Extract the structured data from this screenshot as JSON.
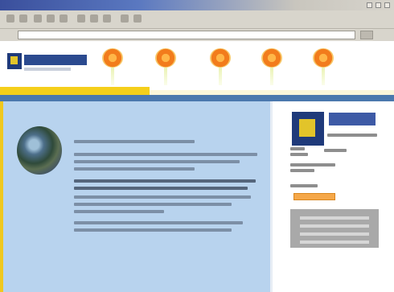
{
  "window": {
    "title": ""
  },
  "address_bar": {
    "url": ""
  },
  "site": {
    "name": "",
    "tagline": ""
  },
  "nav": {
    "items": [
      {
        "label": ""
      },
      {
        "label": ""
      },
      {
        "label": ""
      },
      {
        "label": ""
      },
      {
        "label": ""
      }
    ]
  },
  "main": {
    "headline": "",
    "meta": "",
    "bottom_link": ""
  },
  "sidebar": {
    "name": "",
    "button_label": ""
  },
  "colors": {
    "accent_yellow": "#f5cf1a",
    "header_blue": "#4b78ad",
    "content_blue": "#b8d3ee",
    "nav_orange": "#f27c1c",
    "button_orange": "#f5a84a"
  },
  "icons": {
    "nav": "sunflower-icon",
    "site_logo": "logo-icon",
    "article_image": "globe-image"
  }
}
